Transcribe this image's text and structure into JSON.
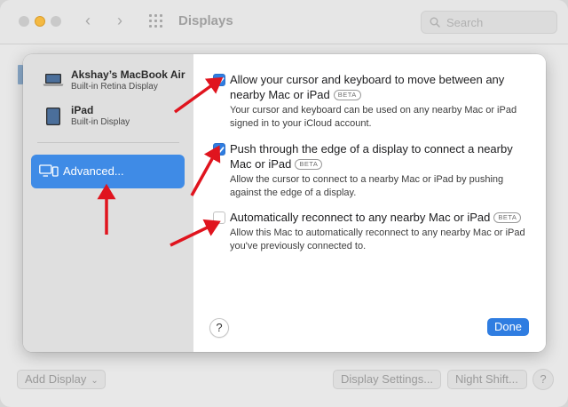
{
  "window": {
    "title": "Displays",
    "search_placeholder": "Search"
  },
  "bottom_bar": {
    "add_display": "Add Display",
    "display_settings": "Display Settings...",
    "night_shift": "Night Shift...",
    "help": "?"
  },
  "sidebar": {
    "devices": [
      {
        "name": "Akshay’s MacBook Air",
        "subtitle": "Built-in Retina Display",
        "icon": "laptop-icon"
      },
      {
        "name": "iPad",
        "subtitle": "Built-in Display",
        "icon": "ipad-icon"
      }
    ],
    "advanced_label": "Advanced..."
  },
  "options": [
    {
      "title": "Allow your cursor and keyboard to move between any nearby Mac or iPad",
      "badge": "BETA",
      "description": "Your cursor and keyboard can be used on any nearby Mac or iPad signed in to your iCloud account.",
      "checked": true
    },
    {
      "title": "Push through the edge of a display to connect a nearby Mac or iPad",
      "badge": "BETA",
      "description": "Allow the cursor to connect to a nearby Mac or iPad by pushing against the edge of a display.",
      "checked": true
    },
    {
      "title": "Automatically reconnect to any nearby Mac or iPad",
      "badge": "BETA",
      "description": "Allow this Mac to automatically reconnect to any nearby Mac or iPad you've previously connected to.",
      "checked": false
    }
  ],
  "sheet_footer": {
    "help": "?",
    "done": "Done"
  },
  "colors": {
    "accent": "#2f7de1",
    "selected_sidebar": "#3f8be6",
    "annotation_arrow": "#e0141e"
  }
}
